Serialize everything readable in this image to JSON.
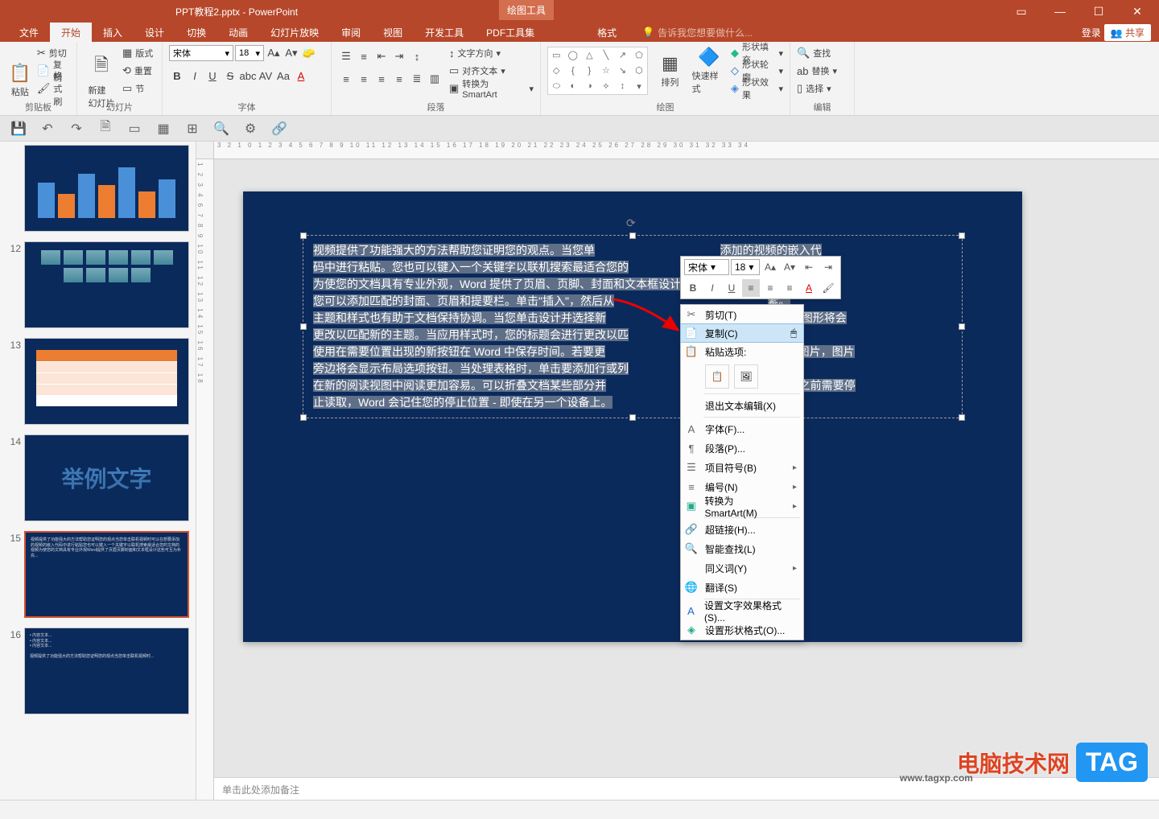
{
  "app": {
    "file_name": "PPT教程2.pptx - PowerPoint",
    "tool_tab": "绘图工具",
    "login": "登录",
    "share": "共享"
  },
  "tabs": {
    "file": "文件",
    "home": "开始",
    "insert": "插入",
    "design": "设计",
    "transition": "切换",
    "animation": "动画",
    "slideshow": "幻灯片放映",
    "review": "审阅",
    "view": "视图",
    "dev": "开发工具",
    "pdf": "PDF工具集",
    "format": "格式",
    "tellme": "告诉我您想要做什么..."
  },
  "ribbon": {
    "clipboard": {
      "label": "剪贴板",
      "paste": "粘贴",
      "cut": "剪切",
      "copy": "复制",
      "fmt": "格式刷"
    },
    "slides": {
      "label": "幻灯片",
      "new": "新建\n幻灯片",
      "layout": "版式",
      "reset": "重置",
      "section": "节"
    },
    "font": {
      "label": "字体",
      "name": "宋体",
      "size": "18"
    },
    "para": {
      "label": "段落",
      "direction": "文字方向",
      "align": "对齐文本",
      "smartart": "转换为 SmartArt"
    },
    "drawing": {
      "label": "绘图",
      "arrange": "排列",
      "quickstyle": "快速样式",
      "fill": "形状填充",
      "outline": "形状轮廓",
      "effects": "形状效果"
    },
    "editing": {
      "label": "编辑",
      "find": "查找",
      "replace": "替换",
      "select": "选择"
    }
  },
  "slides_panel": {
    "numbers": [
      "",
      "12",
      "",
      "13",
      "",
      "14",
      "",
      "15",
      "",
      "16"
    ],
    "sample_text": "举例文字"
  },
  "ruler": {
    "h": "3  2  1  0  1  2  3  4  5  6  7  8  9  10  11  12  13  14  15  16  17  18  19  20  21  22  23  24  25  26  27  28  29  30  31  32  33  34",
    "v": "1  2  3  4  6  7  8  9  10  11  12  13  14  15  16  17  18"
  },
  "slide_text": {
    "l1": "视频提供了功能强大的方法帮助您证明您的观点。当您单",
    "l1b": "添加的视频的嵌入代",
    "l2": "码中进行粘贴。您也可以键入一个关键字以联机搜索最适合您的",
    "l3": "为使您的文档具有专业外观，Word 提供了页眉、页脚、封面和文本框设计，这些设计可互为补充。例如，",
    "l4": "您可以添加匹配的封面、页眉和提要栏。单击\"插入\"，然后从",
    "l4b": "素。",
    "l5": "主题和样式也有助于文档保持协调。当您单击设计并选择新",
    "l5b": "表或 SmartArt 图形将会",
    "l6": "更改以匹配新的主题。当应用样式时，您的标题会进行更改以匹",
    "l7": "使用在需要位置出现的新按钮在 Word 中保存时间。若要更",
    "l7b": "式，请单击该图片，图片",
    "l8": "旁边将会显示布局选项按钮。当处理表格时，单击要添加行或列",
    "l9": "在新的阅读视图中阅读更加容易。可以折叠文档某些部分并",
    "l9b": "在达到结尾处之前需要停",
    "l10": "止读取，Word 会记住您的停止位置 - 即使在另一个设备上。"
  },
  "notes": "单击此处添加备注",
  "mini": {
    "font": "宋体",
    "size": "18"
  },
  "ctx": {
    "cut": "剪切(T)",
    "copy": "复制(C)",
    "paste_label": "粘贴选项:",
    "exit_text": "退出文本编辑(X)",
    "font": "字体(F)...",
    "para": "段落(P)...",
    "bullets": "项目符号(B)",
    "number": "编号(N)",
    "smartart": "转换为 SmartArt(M)",
    "hyperlink": "超链接(H)...",
    "smartlookup": "智能查找(L)",
    "synonyms": "同义词(Y)",
    "translate": "翻译(S)",
    "texteffect": "设置文字效果格式(S)...",
    "shapeformat": "设置形状格式(O)..."
  },
  "watermark": {
    "site": "电脑技术网",
    "url": "www.tagxp.com",
    "tag": "TAG"
  }
}
